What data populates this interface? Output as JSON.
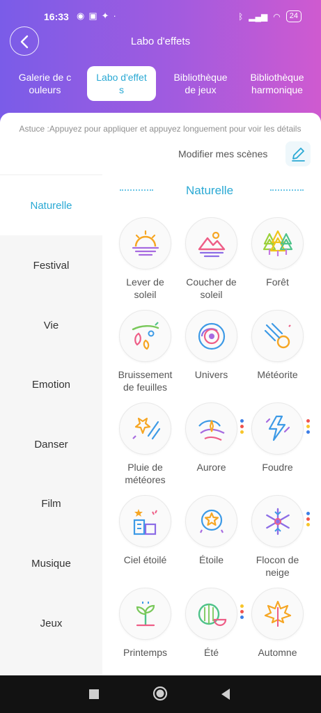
{
  "status": {
    "time": "16:33",
    "battery": "24"
  },
  "header": {
    "title": "Labo d'effets"
  },
  "tabs": [
    {
      "l1": "Galerie de c",
      "l2": "ouleurs"
    },
    {
      "l1": "Labo d'effet",
      "l2": "s"
    },
    {
      "l1": "Bibliothèque",
      "l2": "de jeux"
    },
    {
      "l1": "Bibliothèque",
      "l2": "harmonique"
    }
  ],
  "tip": "Astuce :Appuyez pour appliquer et appuyez longuement pour voir les détails",
  "modify": "Modifier mes scènes",
  "categories": [
    "Naturelle",
    "Festival",
    "Vie",
    "Emotion",
    "Danser",
    "Film",
    "Musique",
    "Jeux"
  ],
  "section_title": "Naturelle",
  "effects": [
    {
      "l1": "Lever de",
      "l2": "soleil"
    },
    {
      "l1": "Coucher de",
      "l2": "soleil"
    },
    {
      "l1": "Forêt",
      "l2": ""
    },
    {
      "l1": "Bruissement",
      "l2": "de feuilles"
    },
    {
      "l1": "Univers",
      "l2": ""
    },
    {
      "l1": "Météorite",
      "l2": ""
    },
    {
      "l1": "Pluie de",
      "l2": "météores"
    },
    {
      "l1": "Aurore",
      "l2": ""
    },
    {
      "l1": "Foudre",
      "l2": ""
    },
    {
      "l1": "Ciel étoilé",
      "l2": ""
    },
    {
      "l1": "Étoile",
      "l2": ""
    },
    {
      "l1": "Flocon de",
      "l2": "neige"
    },
    {
      "l1": "Printemps",
      "l2": ""
    },
    {
      "l1": "Été",
      "l2": ""
    },
    {
      "l1": "Automne",
      "l2": ""
    }
  ],
  "colors": {
    "accent": "#2aa9d4",
    "dot_red": "#f0524c",
    "dot_yellow": "#f7c52a",
    "dot_blue": "#3d7ee6"
  }
}
